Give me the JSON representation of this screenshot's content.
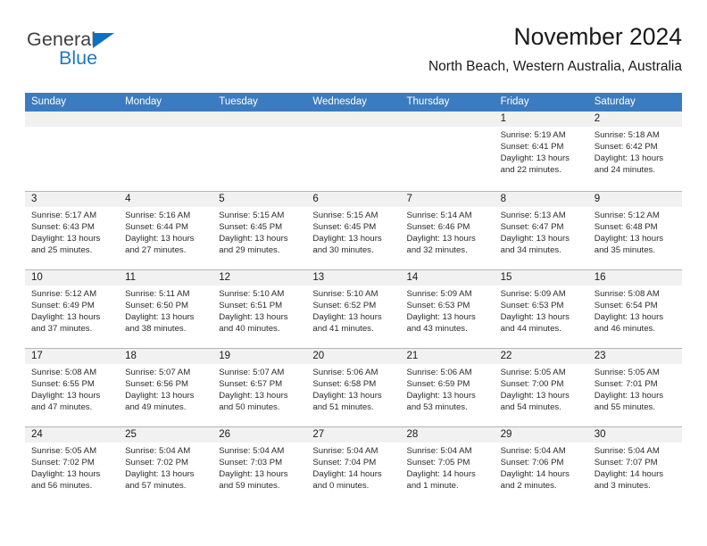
{
  "brand": {
    "name_part1": "General",
    "name_part2": "Blue",
    "triangle_color": "#0f6fc0",
    "blue_color": "#1b7ac4"
  },
  "header": {
    "title": "November 2024",
    "subtitle": "North Beach, Western Australia, Australia"
  },
  "calendar": {
    "accent_color": "#3b7cc0",
    "day_band_color": "#f1f1f1",
    "weekdays": [
      "Sunday",
      "Monday",
      "Tuesday",
      "Wednesday",
      "Thursday",
      "Friday",
      "Saturday"
    ],
    "weeks": [
      [
        {
          "empty": true
        },
        {
          "empty": true
        },
        {
          "empty": true
        },
        {
          "empty": true
        },
        {
          "empty": true
        },
        {
          "date": "1",
          "sunrise": "Sunrise: 5:19 AM",
          "sunset": "Sunset: 6:41 PM",
          "daylight": "Daylight: 13 hours and 22 minutes."
        },
        {
          "date": "2",
          "sunrise": "Sunrise: 5:18 AM",
          "sunset": "Sunset: 6:42 PM",
          "daylight": "Daylight: 13 hours and 24 minutes."
        }
      ],
      [
        {
          "date": "3",
          "sunrise": "Sunrise: 5:17 AM",
          "sunset": "Sunset: 6:43 PM",
          "daylight": "Daylight: 13 hours and 25 minutes."
        },
        {
          "date": "4",
          "sunrise": "Sunrise: 5:16 AM",
          "sunset": "Sunset: 6:44 PM",
          "daylight": "Daylight: 13 hours and 27 minutes."
        },
        {
          "date": "5",
          "sunrise": "Sunrise: 5:15 AM",
          "sunset": "Sunset: 6:45 PM",
          "daylight": "Daylight: 13 hours and 29 minutes."
        },
        {
          "date": "6",
          "sunrise": "Sunrise: 5:15 AM",
          "sunset": "Sunset: 6:45 PM",
          "daylight": "Daylight: 13 hours and 30 minutes."
        },
        {
          "date": "7",
          "sunrise": "Sunrise: 5:14 AM",
          "sunset": "Sunset: 6:46 PM",
          "daylight": "Daylight: 13 hours and 32 minutes."
        },
        {
          "date": "8",
          "sunrise": "Sunrise: 5:13 AM",
          "sunset": "Sunset: 6:47 PM",
          "daylight": "Daylight: 13 hours and 34 minutes."
        },
        {
          "date": "9",
          "sunrise": "Sunrise: 5:12 AM",
          "sunset": "Sunset: 6:48 PM",
          "daylight": "Daylight: 13 hours and 35 minutes."
        }
      ],
      [
        {
          "date": "10",
          "sunrise": "Sunrise: 5:12 AM",
          "sunset": "Sunset: 6:49 PM",
          "daylight": "Daylight: 13 hours and 37 minutes."
        },
        {
          "date": "11",
          "sunrise": "Sunrise: 5:11 AM",
          "sunset": "Sunset: 6:50 PM",
          "daylight": "Daylight: 13 hours and 38 minutes."
        },
        {
          "date": "12",
          "sunrise": "Sunrise: 5:10 AM",
          "sunset": "Sunset: 6:51 PM",
          "daylight": "Daylight: 13 hours and 40 minutes."
        },
        {
          "date": "13",
          "sunrise": "Sunrise: 5:10 AM",
          "sunset": "Sunset: 6:52 PM",
          "daylight": "Daylight: 13 hours and 41 minutes."
        },
        {
          "date": "14",
          "sunrise": "Sunrise: 5:09 AM",
          "sunset": "Sunset: 6:53 PM",
          "daylight": "Daylight: 13 hours and 43 minutes."
        },
        {
          "date": "15",
          "sunrise": "Sunrise: 5:09 AM",
          "sunset": "Sunset: 6:53 PM",
          "daylight": "Daylight: 13 hours and 44 minutes."
        },
        {
          "date": "16",
          "sunrise": "Sunrise: 5:08 AM",
          "sunset": "Sunset: 6:54 PM",
          "daylight": "Daylight: 13 hours and 46 minutes."
        }
      ],
      [
        {
          "date": "17",
          "sunrise": "Sunrise: 5:08 AM",
          "sunset": "Sunset: 6:55 PM",
          "daylight": "Daylight: 13 hours and 47 minutes."
        },
        {
          "date": "18",
          "sunrise": "Sunrise: 5:07 AM",
          "sunset": "Sunset: 6:56 PM",
          "daylight": "Daylight: 13 hours and 49 minutes."
        },
        {
          "date": "19",
          "sunrise": "Sunrise: 5:07 AM",
          "sunset": "Sunset: 6:57 PM",
          "daylight": "Daylight: 13 hours and 50 minutes."
        },
        {
          "date": "20",
          "sunrise": "Sunrise: 5:06 AM",
          "sunset": "Sunset: 6:58 PM",
          "daylight": "Daylight: 13 hours and 51 minutes."
        },
        {
          "date": "21",
          "sunrise": "Sunrise: 5:06 AM",
          "sunset": "Sunset: 6:59 PM",
          "daylight": "Daylight: 13 hours and 53 minutes."
        },
        {
          "date": "22",
          "sunrise": "Sunrise: 5:05 AM",
          "sunset": "Sunset: 7:00 PM",
          "daylight": "Daylight: 13 hours and 54 minutes."
        },
        {
          "date": "23",
          "sunrise": "Sunrise: 5:05 AM",
          "sunset": "Sunset: 7:01 PM",
          "daylight": "Daylight: 13 hours and 55 minutes."
        }
      ],
      [
        {
          "date": "24",
          "sunrise": "Sunrise: 5:05 AM",
          "sunset": "Sunset: 7:02 PM",
          "daylight": "Daylight: 13 hours and 56 minutes."
        },
        {
          "date": "25",
          "sunrise": "Sunrise: 5:04 AM",
          "sunset": "Sunset: 7:02 PM",
          "daylight": "Daylight: 13 hours and 57 minutes."
        },
        {
          "date": "26",
          "sunrise": "Sunrise: 5:04 AM",
          "sunset": "Sunset: 7:03 PM",
          "daylight": "Daylight: 13 hours and 59 minutes."
        },
        {
          "date": "27",
          "sunrise": "Sunrise: 5:04 AM",
          "sunset": "Sunset: 7:04 PM",
          "daylight": "Daylight: 14 hours and 0 minutes."
        },
        {
          "date": "28",
          "sunrise": "Sunrise: 5:04 AM",
          "sunset": "Sunset: 7:05 PM",
          "daylight": "Daylight: 14 hours and 1 minute."
        },
        {
          "date": "29",
          "sunrise": "Sunrise: 5:04 AM",
          "sunset": "Sunset: 7:06 PM",
          "daylight": "Daylight: 14 hours and 2 minutes."
        },
        {
          "date": "30",
          "sunrise": "Sunrise: 5:04 AM",
          "sunset": "Sunset: 7:07 PM",
          "daylight": "Daylight: 14 hours and 3 minutes."
        }
      ]
    ]
  }
}
